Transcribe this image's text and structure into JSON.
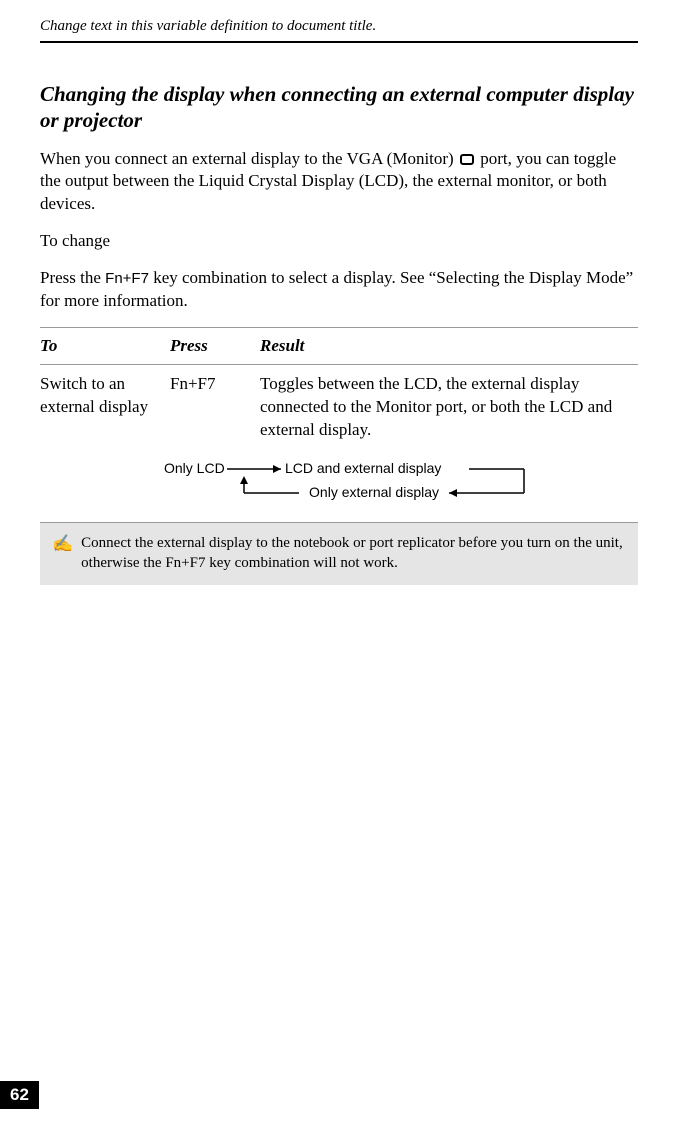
{
  "header": "Change text in this variable definition to document title.",
  "section_title": "Changing the display when connecting an external computer display or projector",
  "para1_a": "When you connect an external display to the VGA (Monitor) ",
  "para1_b": " port, you can toggle the output between the Liquid Crystal Display (LCD), the external monitor, or both devices.",
  "para2": "To change",
  "para3_a": "Press the ",
  "para3_key": "Fn+F7",
  "para3_b": " key combination to select a display. See “Selecting the Display Mode” for more information.",
  "table": {
    "headers": {
      "to": "To",
      "press": "Press",
      "result": "Result"
    },
    "row": {
      "to": "Switch to an external display",
      "press": "Fn+F7",
      "result": "Toggles between the LCD, the external display connected to the Monitor port, or both the LCD and external display."
    }
  },
  "diagram": {
    "only_lcd": "Only LCD",
    "lcd_and_ext": "LCD and external display",
    "only_ext": "Only external display"
  },
  "note": "Connect the external display to the notebook or port replicator before you turn on the unit, otherwise the Fn+F7 key combination will not work.",
  "note_icon": "✍",
  "page_number": "62"
}
